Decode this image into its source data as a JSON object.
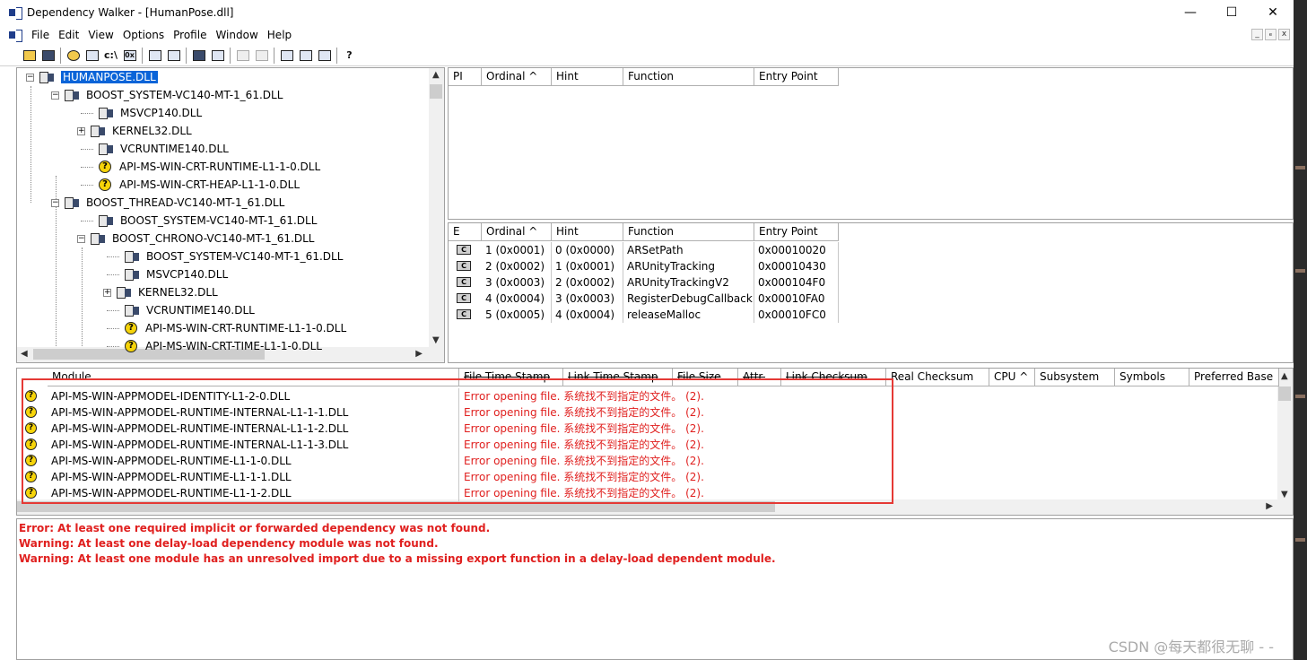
{
  "window": {
    "title": "Dependency Walker - [HumanPose.dll]",
    "minimize": "—",
    "maximize": "☐",
    "close": "✕"
  },
  "menu": {
    "items": [
      "File",
      "Edit",
      "View",
      "Options",
      "Profile",
      "Window",
      "Help"
    ],
    "mdi_min": "_",
    "mdi_restore": "ₑ",
    "mdi_close": "x"
  },
  "toolbar": {
    "buttons": [
      "open",
      "save",
      "find",
      "copy",
      "c:\\",
      "0x",
      "configure",
      "properties",
      "tile",
      "search",
      "prev",
      "next",
      "autoexpand",
      "cascade",
      "tile-horizontal",
      "tile-vertical",
      "help"
    ],
    "labels": {
      "cpath": "c:\\",
      "hex": "0x",
      "help": "?"
    }
  },
  "tree": {
    "items": [
      {
        "label": "HUMANPOSE.DLL",
        "icon": "dll",
        "level": 0,
        "exp": "−"
      },
      {
        "label": "BOOST_SYSTEM-VC140-MT-1_61.DLL",
        "icon": "dll",
        "level": 1,
        "exp": "−"
      },
      {
        "label": "MSVCP140.DLL",
        "icon": "dll",
        "level": 2,
        "exp": ""
      },
      {
        "label": "KERNEL32.DLL",
        "icon": "dll",
        "level": 2,
        "exp": "+"
      },
      {
        "label": "VCRUNTIME140.DLL",
        "icon": "dll",
        "level": 2,
        "exp": ""
      },
      {
        "label": "API-MS-WIN-CRT-RUNTIME-L1-1-0.DLL",
        "icon": "missing",
        "level": 2,
        "exp": ""
      },
      {
        "label": "API-MS-WIN-CRT-HEAP-L1-1-0.DLL",
        "icon": "missing",
        "level": 2,
        "exp": ""
      },
      {
        "label": "BOOST_THREAD-VC140-MT-1_61.DLL",
        "icon": "dll",
        "level": 1,
        "exp": "−"
      },
      {
        "label": "BOOST_SYSTEM-VC140-MT-1_61.DLL",
        "icon": "dll",
        "level": 2,
        "exp": ""
      },
      {
        "label": "BOOST_CHRONO-VC140-MT-1_61.DLL",
        "icon": "dll",
        "level": 2,
        "exp": "−"
      },
      {
        "label": "BOOST_SYSTEM-VC140-MT-1_61.DLL",
        "icon": "dll",
        "level": 3,
        "exp": ""
      },
      {
        "label": "MSVCP140.DLL",
        "icon": "dll",
        "level": 3,
        "exp": ""
      },
      {
        "label": "KERNEL32.DLL",
        "icon": "dll",
        "level": 3,
        "exp": "+"
      },
      {
        "label": "VCRUNTIME140.DLL",
        "icon": "dll",
        "level": 3,
        "exp": ""
      },
      {
        "label": "API-MS-WIN-CRT-RUNTIME-L1-1-0.DLL",
        "icon": "missing",
        "level": 3,
        "exp": ""
      },
      {
        "label": "API-MS-WIN-CRT-TIME-L1-1-0.DLL",
        "icon": "missing",
        "level": 3,
        "exp": ""
      }
    ]
  },
  "imports": {
    "headers": [
      "PI",
      "Ordinal ^",
      "Hint",
      "Function",
      "Entry Point"
    ]
  },
  "exports": {
    "headers": [
      "E",
      "Ordinal ^",
      "Hint",
      "Function",
      "Entry Point"
    ],
    "rows": [
      {
        "ordinal": "1 (0x0001)",
        "hint": "0 (0x0000)",
        "function": "ARSetPath",
        "entry": "0x00010020"
      },
      {
        "ordinal": "2 (0x0002)",
        "hint": "1 (0x0001)",
        "function": "ARUnityTracking",
        "entry": "0x00010430"
      },
      {
        "ordinal": "3 (0x0003)",
        "hint": "2 (0x0002)",
        "function": "ARUnityTrackingV2",
        "entry": "0x000104F0"
      },
      {
        "ordinal": "4 (0x0004)",
        "hint": "3 (0x0003)",
        "function": "RegisterDebugCallback",
        "entry": "0x00010FA0"
      },
      {
        "ordinal": "5 (0x0005)",
        "hint": "4 (0x0004)",
        "function": "releaseMalloc",
        "entry": "0x00010FC0"
      }
    ],
    "icon_label": "C"
  },
  "modules": {
    "headers": [
      "Module",
      "File Time Stamp",
      "Link Time Stamp",
      "File Size",
      "Attr.",
      "Link Checksum",
      "Real Checksum",
      "CPU ^",
      "Subsystem",
      "Symbols",
      "Preferred Base"
    ],
    "rows": [
      {
        "module": "API-MS-WIN-APPMODEL-IDENTITY-L1-2-0.DLL",
        "error": "Error opening file. 系统找不到指定的文件。 (2)."
      },
      {
        "module": "API-MS-WIN-APPMODEL-RUNTIME-INTERNAL-L1-1-1.DLL",
        "error": "Error opening file. 系统找不到指定的文件。 (2)."
      },
      {
        "module": "API-MS-WIN-APPMODEL-RUNTIME-INTERNAL-L1-1-2.DLL",
        "error": "Error opening file. 系统找不到指定的文件。 (2)."
      },
      {
        "module": "API-MS-WIN-APPMODEL-RUNTIME-INTERNAL-L1-1-3.DLL",
        "error": "Error opening file. 系统找不到指定的文件。 (2)."
      },
      {
        "module": "API-MS-WIN-APPMODEL-RUNTIME-L1-1-0.DLL",
        "error": "Error opening file. 系统找不到指定的文件。 (2)."
      },
      {
        "module": "API-MS-WIN-APPMODEL-RUNTIME-L1-1-1.DLL",
        "error": "Error opening file. 系统找不到指定的文件。 (2)."
      },
      {
        "module": "API-MS-WIN-APPMODEL-RUNTIME-L1-1-2.DLL",
        "error": "Error opening file. 系统找不到指定的文件。 (2)."
      }
    ],
    "icon_label": "?"
  },
  "log": {
    "lines": [
      "Error: At least one required implicit or forwarded dependency was not found.",
      "Warning: At least one delay-load dependency module was not found.",
      "Warning: At least one module has an unresolved import due to a missing export function in a delay-load dependent module."
    ]
  },
  "watermark": "CSDN @每天都很无聊 - -",
  "colors": {
    "error": "#e0201f",
    "selection": "#0a64d8",
    "annotation_box": "#e53935"
  }
}
